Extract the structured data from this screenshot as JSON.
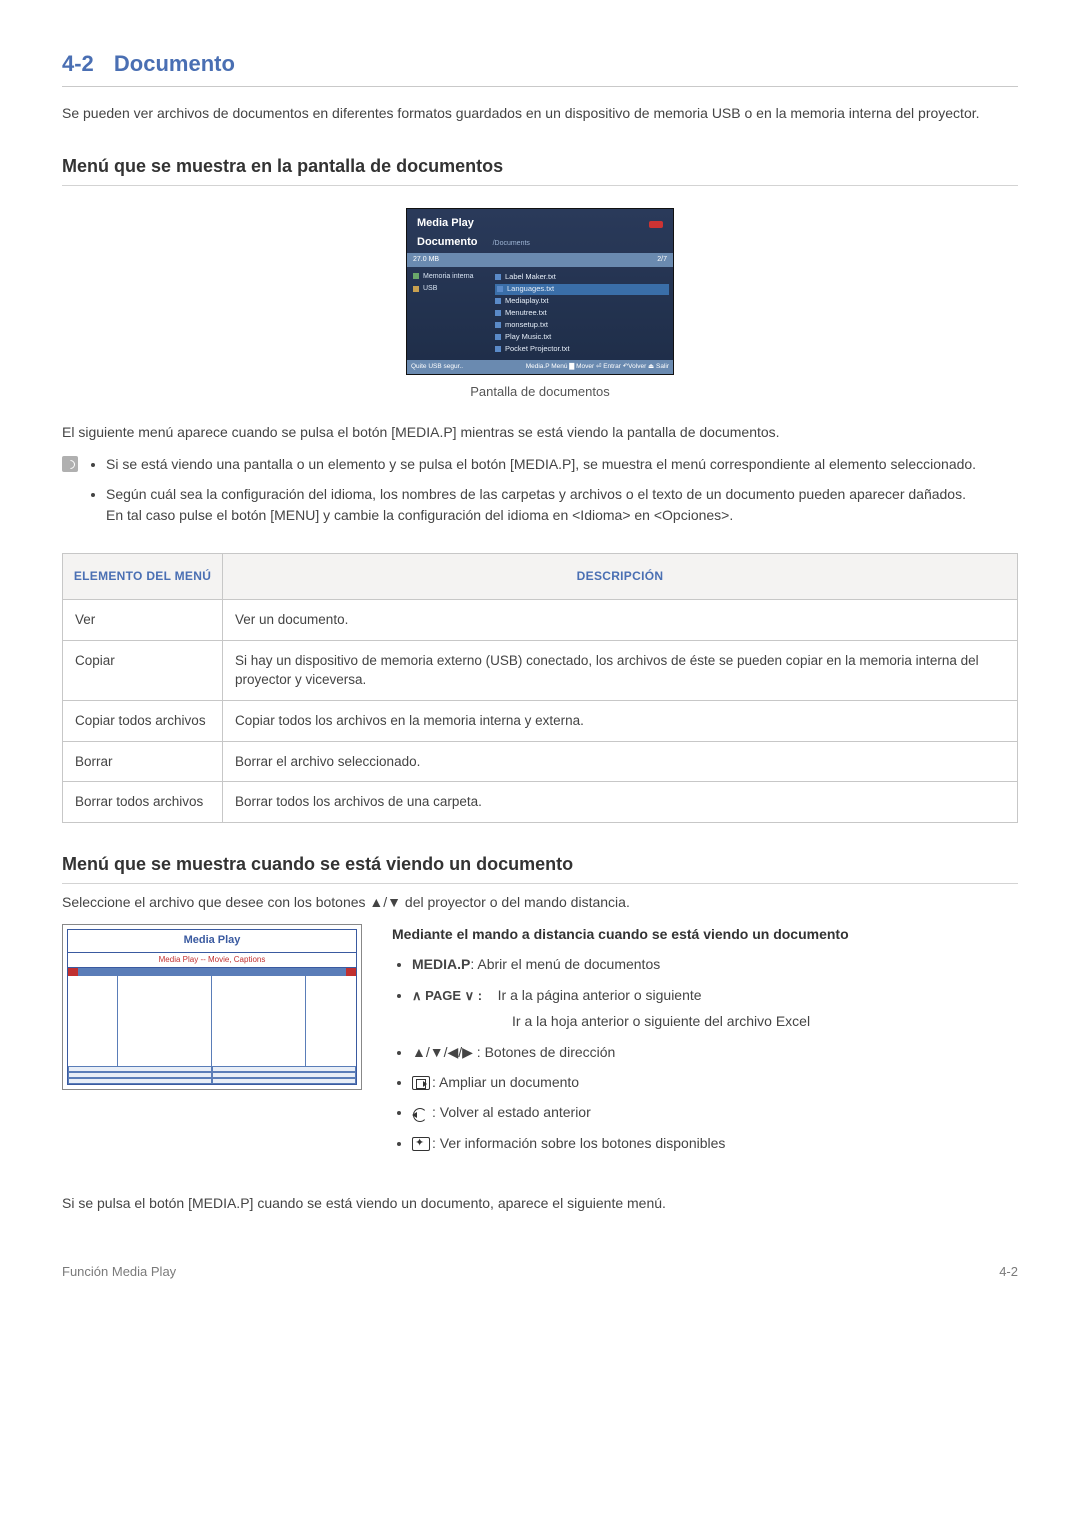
{
  "section": {
    "number": "4-2",
    "title": "Documento"
  },
  "intro": "Se pueden ver archivos de documentos en diferentes formatos guardados en un dispositivo de memoria USB o en la memoria interna del proyector.",
  "sub1": "Menú que se muestra en la pantalla de documentos",
  "screenshot1": {
    "app": "Media Play",
    "mode": "Documento",
    "path": "/Documents",
    "size": "27.0 MB",
    "page": "2/7",
    "side": {
      "mem": "Memoria interna",
      "usb": "USB"
    },
    "files": [
      "Label Maker.txt",
      "Languages.txt",
      "Mediaplay.txt",
      "Menutree.txt",
      "monsetup.txt",
      "Play Music.txt",
      "Pocket Projector.txt"
    ],
    "foot_left": "Quite USB segur..",
    "foot_right": "Media.P Menú  ▇ Mover ⏎ Entrar ↶Volver ⏏ Salir"
  },
  "caption1": "Pantalla de documentos",
  "para1": "El siguiente menú aparece cuando se pulsa el botón [MEDIA.P] mientras se está viendo la pantalla de documentos.",
  "notes": [
    "Si se está viendo una pantalla o un elemento y se pulsa el botón [MEDIA.P], se muestra el menú correspondiente al elemento seleccionado.",
    "Según cuál sea la configuración del idioma, los nombres de las carpetas y archivos o el texto de un documento pueden aparecer dañados.\nEn tal caso pulse el botón [MENU] y cambie la configuración del idioma en <Idioma> en <Opciones>."
  ],
  "table": {
    "head": {
      "c1": "ELEMENTO DEL MENÚ",
      "c2": "DESCRIPCIÓN"
    },
    "rows": [
      {
        "c1": "Ver",
        "c2": "Ver un documento."
      },
      {
        "c1": "Copiar",
        "c2": "Si hay un dispositivo de memoria externo (USB) conectado, los archivos de éste se pueden copiar en la memoria interna del proyector y viceversa."
      },
      {
        "c1": "Copiar todos archivos",
        "c2": "Copiar todos los archivos en la memoria interna y externa."
      },
      {
        "c1": "Borrar",
        "c2": "Borrar el archivo seleccionado."
      },
      {
        "c1": "Borrar todos archivos",
        "c2": "Borrar todos los archivos de una carpeta."
      }
    ]
  },
  "sub2": "Menú que se muestra cuando se está viendo un documento",
  "para2": "Seleccione el archivo que desee con los botones ▲/▼ del proyector o del mando distancia.",
  "mini": {
    "hdr": "Media Play",
    "sub": "Media Play -- Movie, Captions"
  },
  "remote": {
    "title": "Mediante el mando a distancia cuando se está viendo un documento",
    "items": {
      "mediap_key": "MEDIA.P",
      "mediap_txt": ": Abrir el menú de documentos",
      "page_key": "∧ PAGE ∨ :",
      "page_txt": "Ir a la página anterior o siguiente",
      "page_indent": "Ir a la hoja anterior o siguiente del archivo Excel",
      "dir": "▲/▼/◀/▶ : Botones de dirección",
      "zoom": ": Ampliar un documento",
      "back": ": Volver al estado anterior",
      "info": ": Ver información sobre los botones disponibles"
    }
  },
  "para3": "Si se pulsa el botón [MEDIA.P] cuando se está viendo un documento, aparece el siguiente menú.",
  "footer": {
    "left": "Función Media Play",
    "right": "4-2"
  }
}
